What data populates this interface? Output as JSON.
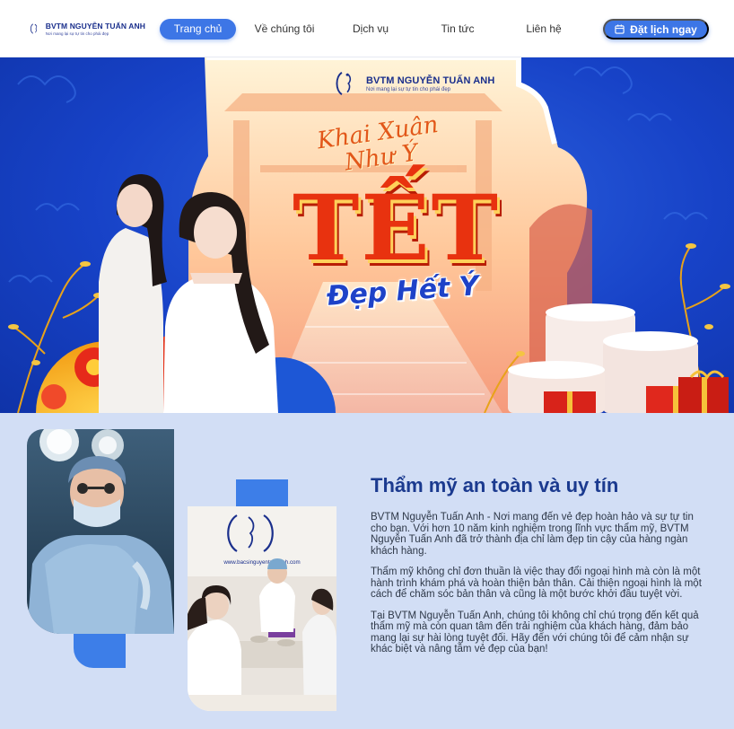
{
  "header": {
    "logo": {
      "name": "BVTM NGUYỄN TUẤN ANH",
      "tagline": "Nơi mang lại sự tự tin cho phái đẹp"
    },
    "nav": [
      {
        "label": "Trang chủ",
        "active": true
      },
      {
        "label": "Về chúng tôi",
        "active": false
      },
      {
        "label": "Dịch vụ",
        "active": false
      },
      {
        "label": "Tin tức",
        "active": false
      },
      {
        "label": "Liên hệ",
        "active": false
      }
    ],
    "cta": {
      "label": "Đặt lịch ngay",
      "icon": "calendar-icon"
    }
  },
  "hero": {
    "logo": {
      "name": "BVTM NGUYỄN TUẤN ANH",
      "tagline": "Nơi mang lại sự tự tin cho phái đẹp"
    },
    "headline_top": "Khai Xuân Như Ý",
    "headline_main": "TẾT",
    "headline_bottom": "Đẹp Hết Ý"
  },
  "about": {
    "title": "Thẩm mỹ an toàn và uy tín",
    "paragraphs": [
      "BVTM Nguyễn Tuấn Anh - Nơi mang đến vẻ đẹp hoàn hảo và sự tự tin cho bạn. Với hơn 10 năm kinh nghiệm trong lĩnh vực thẩm mỹ, BVTM Nguyễn Tuấn Anh đã trở thành địa chỉ làm đẹp tin cậy của hàng ngàn khách hàng.",
      "Thẩm mỹ không chỉ đơn thuần là việc thay đổi ngoại hình mà còn là một hành trình khám phá và hoàn thiện bản thân. Cải thiện ngoại hình là một cách để chăm sóc bản thân và cũng là một bước khởi đầu tuyệt vời.",
      "Tại BVTM Nguyễn Tuấn Anh, chúng tôi không chỉ chú trọng đến kết quả thẩm mỹ mà còn quan tâm đến trải nghiệm của khách hàng, đảm bảo mang lại sự hài lòng tuyệt đối. Hãy đến với chúng tôi để cảm nhận sự khác biệt và nâng tầm vẻ đẹp của bạn!"
    ],
    "clinic_image": {
      "website": "www.bacsinguyentuananh.com"
    }
  },
  "colors": {
    "primary": "#3d76e6",
    "brand_dark": "#1a2f8c",
    "section_bg": "#d2def5",
    "hero_blue": "#1742c7",
    "tet_red": "#e8320f"
  }
}
